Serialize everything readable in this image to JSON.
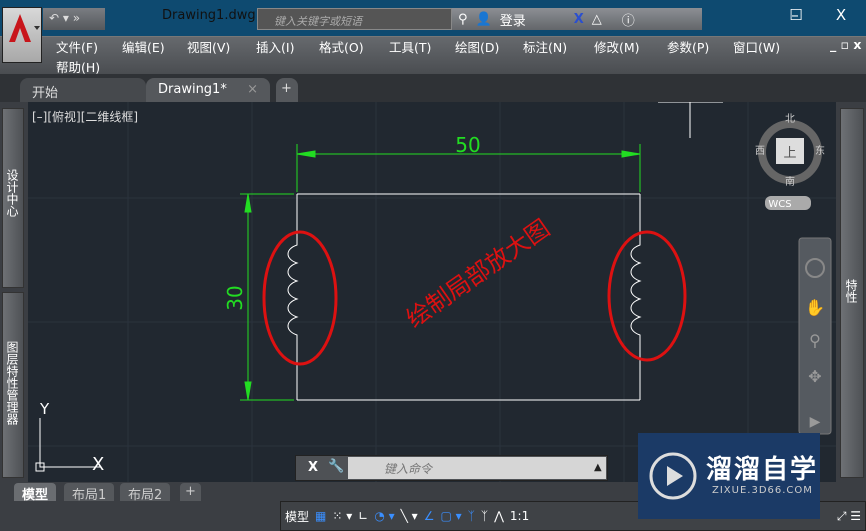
{
  "title_bar": {
    "document_title": "Drawing1.dwg",
    "search_placeholder": "键入关键字或短语",
    "login_label": "登录",
    "minimize": "–",
    "maximize": "☐",
    "close": "X"
  },
  "menu": {
    "items": [
      "文件(F)",
      "编辑(E)",
      "视图(V)",
      "插入(I)",
      "格式(O)",
      "工具(T)",
      "绘图(D)",
      "标注(N)",
      "修改(M)",
      "参数(P)",
      "窗口(W)",
      "帮助(H)"
    ],
    "doc_controls": "_ ▫ x"
  },
  "file_tabs": [
    {
      "label": "开始"
    },
    {
      "label": "Drawing1*",
      "close": "×"
    }
  ],
  "new_tab": "+",
  "viewport": {
    "label": "[–][俯视][二维线框]"
  },
  "viewcube": {
    "north": "北",
    "south": "南",
    "east": "东",
    "west": "西",
    "top": "上",
    "wcs": "WCS"
  },
  "drawing": {
    "dim_horizontal": "50",
    "dim_vertical": "30",
    "annotation": "绘制局部放大图",
    "axis_x": "X",
    "axis_y": "Y",
    "colors": {
      "dimension": "#22dd22",
      "annotation": "#dd1111",
      "geometry": "#ffffff"
    }
  },
  "palettes": {
    "left_top": "设计中心",
    "left_bottom": "图层特性管理器",
    "right": "特性"
  },
  "command_line": {
    "close": "X",
    "placeholder": "键入命令",
    "arrow": "▲"
  },
  "layout_tabs": [
    "模型",
    "布局1",
    "布局2"
  ],
  "add_layout": "+",
  "status_bar": {
    "model": "模型",
    "scale": "1:1"
  },
  "watermark": {
    "brand": "溜溜自学",
    "url": "ZIXUE.3D66.COM"
  }
}
